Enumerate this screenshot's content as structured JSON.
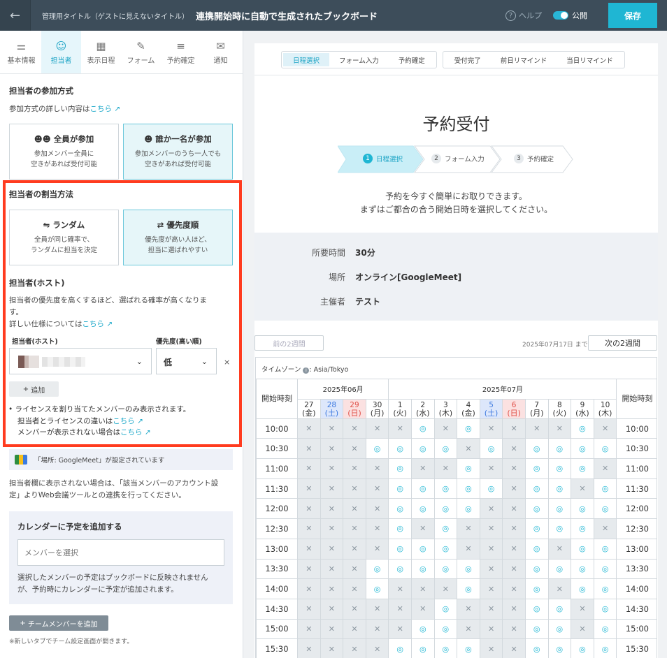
{
  "header": {
    "admin_label": "管理用タイトル（ゲストに見えないタイトル）",
    "title": "連携開始時に自動で生成されたブックボード",
    "help": "ヘルプ",
    "publish": "公開",
    "save": "保存"
  },
  "tabs": [
    {
      "label": "基本情報",
      "icon": "sliders-icon"
    },
    {
      "label": "担当者",
      "icon": "people-icon"
    },
    {
      "label": "表示日程",
      "icon": "calendar-icon"
    },
    {
      "label": "フォーム",
      "icon": "form-icon"
    },
    {
      "label": "予約確定",
      "icon": "checklist-icon"
    },
    {
      "label": "通知",
      "icon": "mail-icon"
    }
  ],
  "participation": {
    "title": "担当者の参加方式",
    "desc": "参加方式の詳しい内容は",
    "link": "こちら",
    "all": {
      "title": "全員が参加",
      "desc1": "参加メンバー全員に",
      "desc2": "空きがあれば受付可能"
    },
    "one": {
      "title": "誰か一名が参加",
      "desc1": "参加メンバーのうち一人でも",
      "desc2": "空きがあれば受付可能"
    }
  },
  "assignment": {
    "title": "担当者の割当方法",
    "random": {
      "title": "ランダム",
      "desc1": "全員が同じ確率で、",
      "desc2": "ランダムに担当を決定"
    },
    "priority": {
      "title": "優先度順",
      "desc1": "優先度が高い人ほど、",
      "desc2": "担当に選ばれやすい"
    }
  },
  "host": {
    "title": "担当者(ホスト)",
    "desc1": "担当者の優先度を高くするほど、選ばれる確率が高くなりま",
    "desc2": "す。",
    "desc3": "詳しい仕様については",
    "link": "こちら",
    "col_host": "担当者(ホスト)",
    "col_priority": "優先度(高い順)",
    "priority_value": "低",
    "remove": "×",
    "add": "追加",
    "note1": "ライセンスを割り当てたメンバーのみ表示されます。",
    "note2": "担当者とライセンスの違いは",
    "note3": "メンバーが表示されない場合は",
    "note_link": "こちら"
  },
  "meet_notice": "「場所: GoogleMeet」が設定されています",
  "meet_desc1": "担当者欄に表示されない場合は、「該当メンバーのアカウント設",
  "meet_desc2": "定」よりWeb会議ツールとの連携を行ってください。",
  "calendar_add": {
    "title": "カレンダーに予定を追加する",
    "placeholder": "メンバーを選択",
    "desc1": "選択したメンバーの予定はブックボードに反映されません",
    "desc2": "が、予約時にカレンダーに予定が追加されます。"
  },
  "team_button": "チームメンバーを追加",
  "team_note": "※新しいタブでチーム設定画面が開きます。",
  "preview": {
    "segments_a": [
      "日程選択",
      "フォーム入力",
      "予約確定"
    ],
    "segments_b": [
      "受付完了",
      "前日リマインド",
      "当日リマインド"
    ],
    "heading": "予約受付",
    "steps": [
      {
        "num": "1",
        "label": "日程選択"
      },
      {
        "num": "2",
        "label": "フォーム入力"
      },
      {
        "num": "3",
        "label": "予約確定"
      }
    ],
    "intro1": "予約を今すぐ簡単にお取りできます。",
    "intro2": "まずはご都合の合う開始日時を選択してください。",
    "duration_label": "所要時間",
    "duration": "30分",
    "place_label": "場所",
    "place": "オンライン[GoogleMeet]",
    "host_label": "主催者",
    "host": "テスト",
    "prev": "前の2週間",
    "next": "次の2週間",
    "until": "2025年07月17日 まで",
    "timezone": "タイムゾーン",
    "timezone_val": ": Asia/Tokyo",
    "start_time": "開始時刻",
    "month1": "2025年06月",
    "month2": "2025年07月",
    "days": [
      {
        "d": "27",
        "w": "(金)",
        "t": ""
      },
      {
        "d": "28",
        "w": "(土)",
        "t": "sat"
      },
      {
        "d": "29",
        "w": "(日)",
        "t": "sun"
      },
      {
        "d": "30",
        "w": "(月)",
        "t": ""
      },
      {
        "d": "1",
        "w": "(火)",
        "t": ""
      },
      {
        "d": "2",
        "w": "(水)",
        "t": ""
      },
      {
        "d": "3",
        "w": "(木)",
        "t": ""
      },
      {
        "d": "4",
        "w": "(金)",
        "t": ""
      },
      {
        "d": "5",
        "w": "(土)",
        "t": "sat"
      },
      {
        "d": "6",
        "w": "(日)",
        "t": "sun"
      },
      {
        "d": "7",
        "w": "(月)",
        "t": ""
      },
      {
        "d": "8",
        "w": "(火)",
        "t": ""
      },
      {
        "d": "9",
        "w": "(水)",
        "t": ""
      },
      {
        "d": "10",
        "w": "(木)",
        "t": ""
      }
    ],
    "slots": [
      {
        "time": "10:00",
        "s": "xxxxxoxoxxxxox"
      },
      {
        "time": "10:30",
        "s": "xxxooooxoxoooo"
      },
      {
        "time": "11:00",
        "s": "xxxxoxxoxxooox"
      },
      {
        "time": "11:30",
        "s": "xxxxoooooxooxo"
      },
      {
        "time": "12:00",
        "s": "xxxxooooxxoooo"
      },
      {
        "time": "12:30",
        "s": "xxxxoxoxxxooox"
      },
      {
        "time": "13:00",
        "s": "xxxxoooxxxoxoo"
      },
      {
        "time": "13:30",
        "s": "xxxoooooxxoooo"
      },
      {
        "time": "14:00",
        "s": "xxxoxxxoxxoxoo"
      },
      {
        "time": "14:30",
        "s": "xxxxxxoxxxooxo"
      },
      {
        "time": "15:00",
        "s": "xxxxxooxxxooxo"
      },
      {
        "time": "15:30",
        "s": "xxxxooooxxoooo"
      }
    ],
    "mark_o": "◎",
    "mark_x": "✕"
  }
}
